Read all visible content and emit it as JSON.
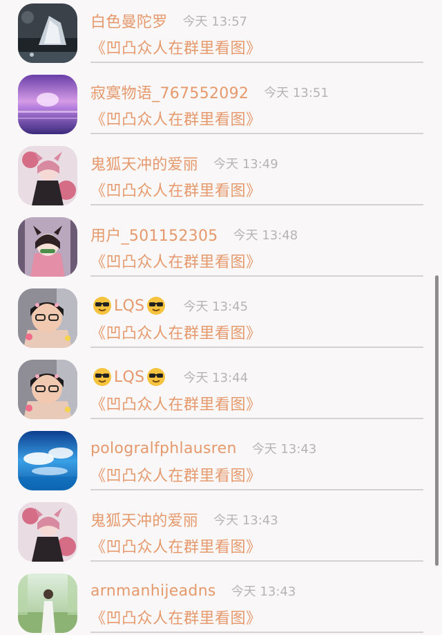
{
  "message_text": "《凹凸众人在群里看图》",
  "items": [
    {
      "name": "白色曼陀罗",
      "time": "今天 13:57",
      "avatar": "crystal-landscape"
    },
    {
      "name": "寂寞物语_767552092",
      "time": "今天 13:51",
      "avatar": "purple-sky"
    },
    {
      "name": "鬼狐天冲的爱丽",
      "time": "今天 13:49",
      "avatar": "anime-girl-pink"
    },
    {
      "name": "用户_501152305",
      "time": "今天 13:48",
      "avatar": "anime-girl-bamboo"
    },
    {
      "name": "LQS",
      "time": "今天 13:45",
      "avatar": "girl-glasses",
      "emoji": "sunglasses-face"
    },
    {
      "name": "LQS",
      "time": "今天 13:44",
      "avatar": "girl-glasses",
      "emoji": "sunglasses-face"
    },
    {
      "name": "pologralfphlausren",
      "time": "今天 13:43",
      "avatar": "blue-sky-clouds"
    },
    {
      "name": "鬼狐天冲的爱丽",
      "time": "今天 13:43",
      "avatar": "anime-girl-pink"
    },
    {
      "name": "arnmanhijeadns",
      "time": "今天 13:43",
      "avatar": "girl-in-field"
    }
  ],
  "colors": {
    "accent": "#e5996c",
    "time": "#b5b3b3",
    "background": "#f9f7f8",
    "divider": "#d3d1d2"
  }
}
